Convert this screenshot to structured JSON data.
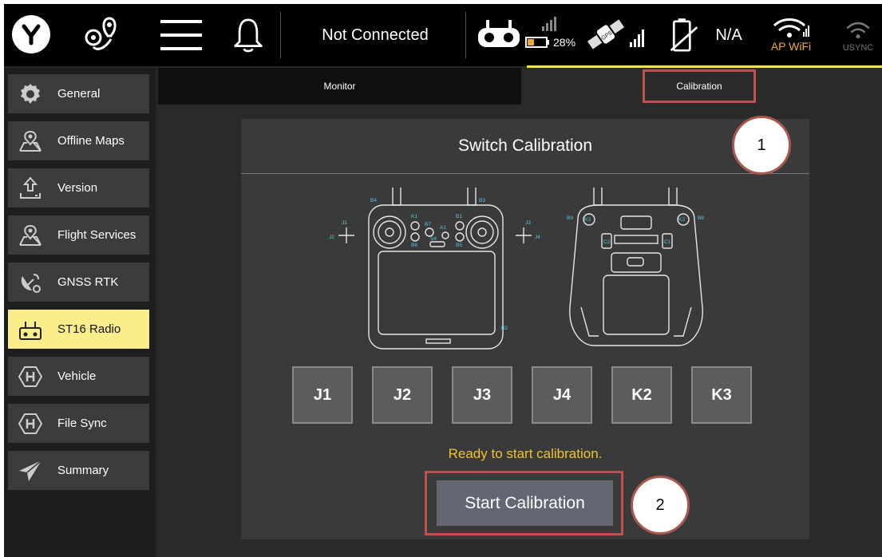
{
  "topbar": {
    "connection_status": "Not Connected",
    "rc_battery_pct": "28%",
    "drone_battery": "N/A",
    "wifi_label": "AP WiFi",
    "usync_label": "USYNC",
    "accent_color": "#f4dd64"
  },
  "sidebar": {
    "items": [
      {
        "label": "General",
        "icon": "gear-icon"
      },
      {
        "label": "Offline Maps",
        "icon": "map-pin-icon"
      },
      {
        "label": "Version",
        "icon": "upload-icon"
      },
      {
        "label": "Flight Services",
        "icon": "map-pin-icon"
      },
      {
        "label": "GNSS RTK",
        "icon": "satellite-dish-icon"
      },
      {
        "label": "ST16 Radio",
        "icon": "remote-control-icon",
        "active": true
      },
      {
        "label": "Vehicle",
        "icon": "hexagon-h-icon"
      },
      {
        "label": "File Sync",
        "icon": "hexagon-h-icon"
      },
      {
        "label": "Summary",
        "icon": "paper-plane-icon"
      }
    ],
    "active_color": "#fbec8c"
  },
  "tabs": {
    "monitor": "Monitor",
    "calibration": "Calibration"
  },
  "panel": {
    "title": "Switch Calibration",
    "switches": [
      "J1",
      "J2",
      "J3",
      "J4",
      "K2",
      "K3"
    ],
    "status": "Ready to start calibration.",
    "start_button": "Start Calibration",
    "figure_labels": {
      "front": [
        "J1",
        "J2",
        "J3",
        "J4",
        "B4",
        "B3",
        "K1",
        "B7",
        "B1",
        "A1",
        "B6",
        "B5",
        "S4",
        "B2"
      ],
      "back": [
        "B9",
        "K3",
        "K2",
        "B8",
        "C2",
        "C1"
      ]
    }
  },
  "callouts": [
    "1",
    "2"
  ],
  "colors": {
    "callout_border": "#c0504d",
    "status_text": "#f1c232",
    "wifi_label": "#f0a83a"
  }
}
